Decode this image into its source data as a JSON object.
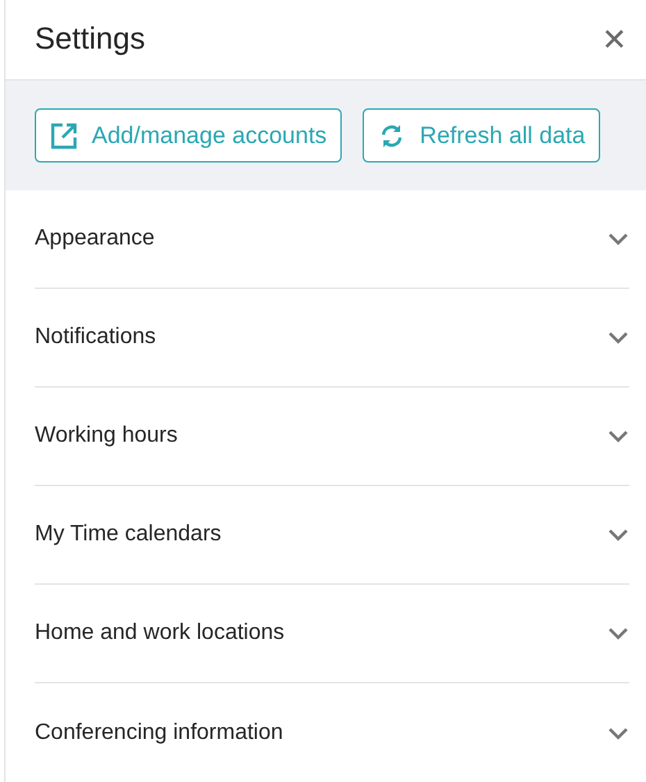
{
  "title": "Settings",
  "close": "✕",
  "buttons": [
    {
      "label": "Add/manage accounts",
      "kind": "external"
    },
    {
      "label": "Refresh all data",
      "kind": "refresh"
    }
  ],
  "sections": [
    {
      "label": "Appearance",
      "expanded": false
    },
    {
      "label": "Notifications",
      "expanded": false
    },
    {
      "label": "Working hours",
      "expanded": false
    },
    {
      "label": "My Time calendars",
      "expanded": false
    },
    {
      "label": "Home and work locations",
      "expanded": false
    },
    {
      "label": "Conferencing information",
      "expanded": false
    }
  ]
}
